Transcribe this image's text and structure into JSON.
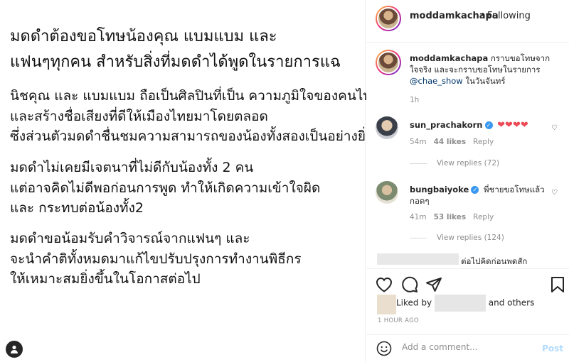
{
  "post_image": {
    "paragraphs": [
      [
        "มดดำต้องขอโทษน้องคุณ แบมแบม และ",
        "แฟนๆทุกคน สำหรับสิ่งที่มดดำได้พูดในรายการแฉ"
      ],
      [
        "นิชคุณ และ แบมแบม ถือเป็นศิลปินที่เป็น ความภูมิใจของคนไทย",
        "และสร้างชื่อเสียงที่ดีให้เมืองไทยมาโดยตลอด",
        "ซึ่งส่วนตัวมดดำชื่นชมความสามารถของน้องทั้งสองเป็นอย่างยิ่ง"
      ],
      [
        "มดดำไม่เคยมีเจตนาที่ไม่ดีกับน้องทั้ง 2 คน",
        "แต่อาจคิดไม่ดีพอก่อนการพูด ทำให้เกิดความเข้าใจผิด",
        " และ กระทบต่อน้องทั้ง2"
      ],
      [
        "มดดำขอน้อมรับคำวิจารณ์จากแฟนๆ และ",
        "จะนำคำติทั้งหมดมาแก้ไขปรับปรุงการทำงานพิธีกร",
        "ให้เหมาะสมยิ่งขึ้นในโอกาสต่อไป"
      ]
    ]
  },
  "header": {
    "username": "moddamkachapa",
    "separator": "•",
    "follow_status": "Following"
  },
  "caption": {
    "username": "moddamkachapa",
    "text_1": "กราบขอโทษจากใจจริง และจะกราบขอโทษในรายการ",
    "mention": "@chae_show",
    "text_2": "ในวันจันทร์",
    "time": "1h"
  },
  "comments": [
    {
      "username": "sun_prachakorn",
      "text": "❤❤❤❤",
      "time": "54m",
      "likes": "44 likes",
      "reply": "Reply",
      "view_replies": "View replies (72)"
    },
    {
      "username": "bungbaiyoke",
      "text": "พี่ชายขอโทษแล้ว กอดๆ",
      "time": "41m",
      "likes": "53 likes",
      "reply": "Reply",
      "view_replies": "View replies (124)"
    },
    {
      "text": "ต่อไปคิดก่อนพดสัก"
    }
  ],
  "likes": {
    "prefix": "Liked by",
    "suffix": "and others"
  },
  "timestamp": "1 HOUR AGO",
  "add_comment": {
    "placeholder": "Add a comment...",
    "post_label": "Post"
  },
  "colors": {
    "link": "#00376b",
    "verified": "#3897f0",
    "heart": "#ed4956",
    "post_disabled": "#b3dbff"
  }
}
